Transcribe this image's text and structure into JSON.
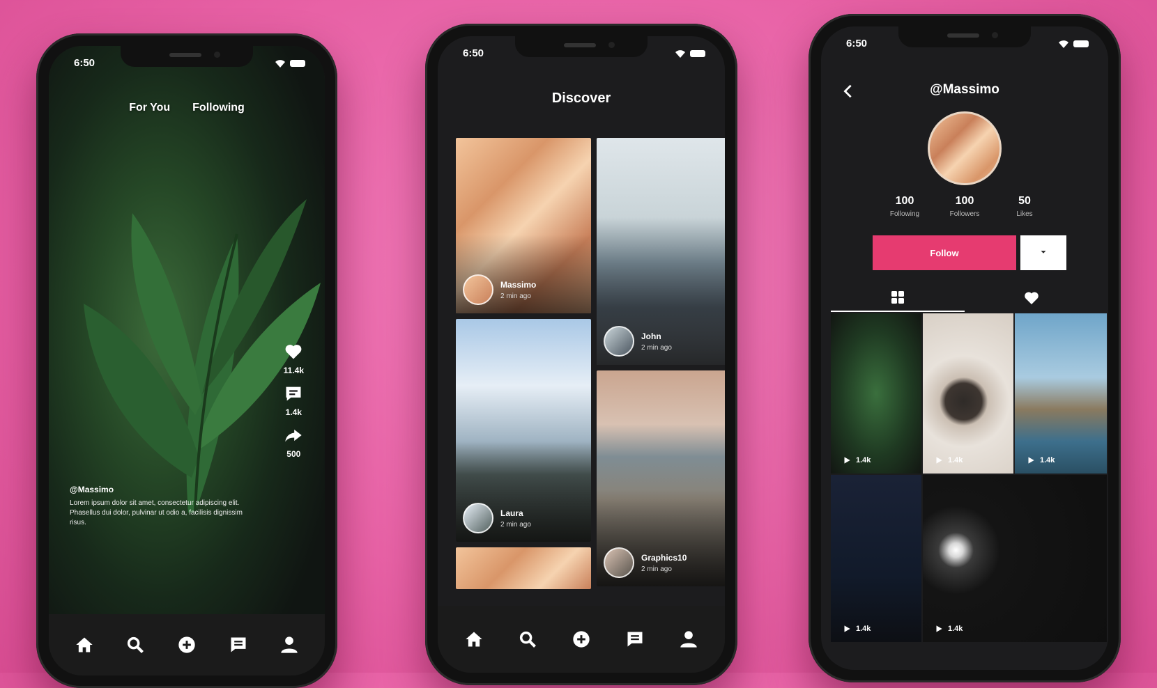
{
  "status": {
    "time": "6:50"
  },
  "feed": {
    "tabs": [
      "For You",
      "Following"
    ],
    "likes": "11.4k",
    "comments": "1.4k",
    "shares": "500",
    "username": "@Massimo",
    "caption": "Lorem ipsum dolor sit amet, consectetur adipiscing elit. Phasellus dui dolor, pulvinar ut odio a, facilisis dignissim risus."
  },
  "discover": {
    "title": "Discover",
    "cards": [
      {
        "name": "Massimo",
        "time": "2 min ago"
      },
      {
        "name": "John",
        "time": "2 min ago"
      },
      {
        "name": "Laura",
        "time": "2 min ago"
      },
      {
        "name": "Graphics10",
        "time": "2 min ago"
      }
    ]
  },
  "profile": {
    "handle": "@Massimo",
    "stats": [
      {
        "value": "100",
        "label": "Following"
      },
      {
        "value": "100",
        "label": "Followers"
      },
      {
        "value": "50",
        "label": "Likes"
      }
    ],
    "follow_label": "Follow",
    "tiles": [
      {
        "plays": "1.4k"
      },
      {
        "plays": "1.4k"
      },
      {
        "plays": "1.4k"
      },
      {
        "plays": "1.4k"
      },
      {
        "plays": "1.4k"
      }
    ]
  },
  "nav_icons": [
    "home-icon",
    "search-icon",
    "add-icon",
    "messages-icon",
    "profile-icon"
  ],
  "colors": {
    "background": "#e862a6",
    "accent": "#e63b70",
    "screen": "#1c1c1e"
  }
}
